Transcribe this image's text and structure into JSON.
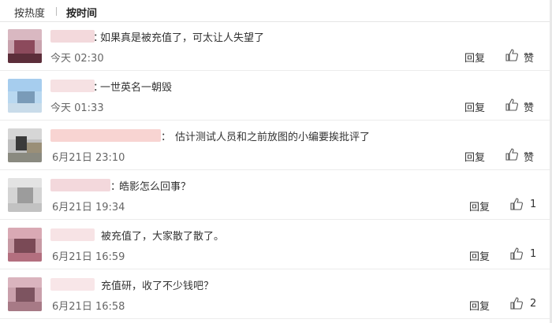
{
  "tabs": {
    "hot": "按热度",
    "time": "按时间"
  },
  "comments": [
    {
      "text": "如果真是被充值了，可太让人失望了",
      "time": "今天 02:30",
      "reply": "回复",
      "like": "赞"
    },
    {
      "text": "一世英名一朝毁",
      "time": "今天 01:33",
      "reply": "回复",
      "like": "赞"
    },
    {
      "text": "估计测试人员和之前放图的小编要挨批评了",
      "time": "6月21日 23:10",
      "reply": "回复",
      "like": "赞"
    },
    {
      "text": "皓影怎么回事？",
      "time": "6月21日 19:34",
      "reply": "回复",
      "like": "1"
    },
    {
      "text": "被充值了，大家散了散了。",
      "time": "6月21日 16:59",
      "reply": "回复",
      "like": "1"
    },
    {
      "text": "充值研，收了不少钱吧？",
      "time": "6月21日 16:58",
      "reply": "回复",
      "like": "2"
    }
  ],
  "colon": "："
}
